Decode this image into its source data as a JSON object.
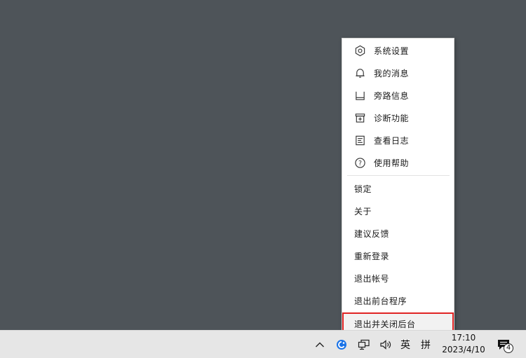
{
  "menu": {
    "items_top": [
      {
        "label": "系统设置",
        "icon": "gear-icon"
      },
      {
        "label": "我的消息",
        "icon": "bell-icon"
      },
      {
        "label": "旁路信息",
        "icon": "bypass-icon"
      },
      {
        "label": "诊断功能",
        "icon": "diagnose-icon"
      },
      {
        "label": "查看日志",
        "icon": "log-icon"
      },
      {
        "label": "使用帮助",
        "icon": "help-icon"
      }
    ],
    "items_bottom": [
      {
        "label": "锁定"
      },
      {
        "label": "关于"
      },
      {
        "label": "建议反馈"
      },
      {
        "label": "重新登录"
      },
      {
        "label": "退出帐号"
      },
      {
        "label": "退出前台程序"
      },
      {
        "label": "退出并关闭后台"
      }
    ],
    "highlight_color": "#e02424"
  },
  "taskbar": {
    "ime_lang": "英",
    "ime_mode": "拼",
    "time": "17:10",
    "date": "2023/4/10",
    "notification_count": "4",
    "accent": "#1a73e8"
  }
}
